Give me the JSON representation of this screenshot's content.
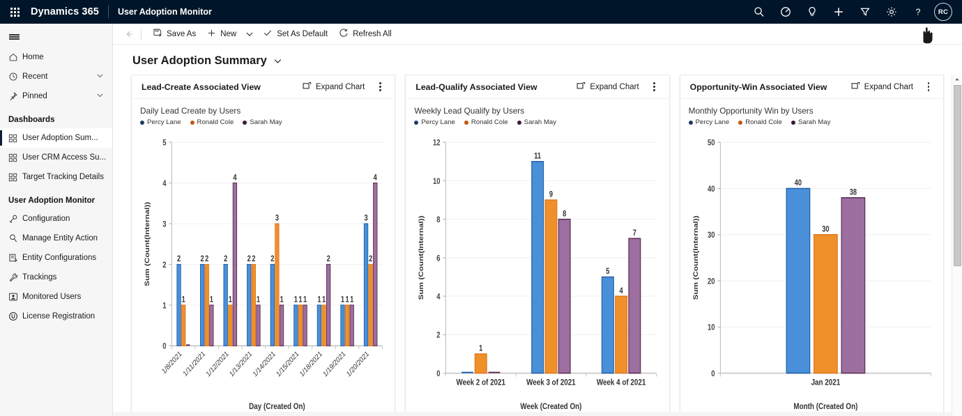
{
  "topbar": {
    "waffle_label": "app-launcher",
    "brand": "Dynamics 365",
    "app_name": "User Adoption Monitor",
    "avatar_initials": "RC",
    "icons": [
      {
        "name": "search-icon",
        "title": "Search"
      },
      {
        "name": "timer-icon",
        "title": "Focused view"
      },
      {
        "name": "lightbulb-icon",
        "title": "Assistant"
      },
      {
        "name": "plus-icon",
        "title": "Quick create"
      },
      {
        "name": "filter-icon",
        "title": "Filter"
      },
      {
        "name": "gear-icon",
        "title": "Settings"
      },
      {
        "name": "help-icon",
        "title": "Help"
      }
    ]
  },
  "sidebar": {
    "top_items": [
      {
        "label": "Home",
        "icon": "home-icon",
        "chevron": false
      },
      {
        "label": "Recent",
        "icon": "clock-icon",
        "chevron": true
      },
      {
        "label": "Pinned",
        "icon": "pin-icon",
        "chevron": true
      }
    ],
    "dashboards_header": "Dashboards",
    "dashboard_items": [
      {
        "label": "User Adoption Sum...",
        "icon": "dashboard-icon",
        "selected": true
      },
      {
        "label": "User CRM Access Su...",
        "icon": "dashboard-icon",
        "selected": false
      },
      {
        "label": "Target Tracking Details",
        "icon": "dashboard-icon",
        "selected": false
      }
    ],
    "monitor_header": "User Adoption Monitor",
    "monitor_items": [
      {
        "label": "Configuration",
        "icon": "key-icon"
      },
      {
        "label": "Manage Entity Action",
        "icon": "search-small-icon"
      },
      {
        "label": "Entity Configurations",
        "icon": "entity-icon"
      },
      {
        "label": "Trackings",
        "icon": "wrench-icon"
      },
      {
        "label": "Monitored Users",
        "icon": "user-box-icon"
      },
      {
        "label": "License Registration",
        "icon": "license-icon"
      }
    ]
  },
  "commandbar": {
    "back_label": "Back",
    "buttons": [
      {
        "label": "Save As",
        "icon": "save-as-icon",
        "caret": false
      },
      {
        "label": "New",
        "icon": "plus-icon",
        "caret": true
      },
      {
        "label": "Set As Default",
        "icon": "check-icon",
        "caret": false
      },
      {
        "label": "Refresh All",
        "icon": "refresh-icon",
        "caret": false
      }
    ]
  },
  "page": {
    "title": "User Adoption Summary"
  },
  "colors": {
    "series_percy": "#1f5ea8",
    "series_ronald": "#e0761a",
    "series_sarah": "#5c2a52",
    "series_percy_light": "#4a90d9",
    "series_ronald_light": "#f0902b",
    "series_sarah_light": "#9c6fa0",
    "nav_selected_bar": "#0b1f3a",
    "topbar_bg": "#001529"
  },
  "cards": [
    {
      "title": "Lead-Create Associated View",
      "expand_label": "Expand Chart",
      "more_label": "More commands"
    },
    {
      "title": "Lead-Qualify Associated View",
      "expand_label": "Expand Chart",
      "more_label": "More commands"
    },
    {
      "title": "Opportunity-Win Associated View",
      "expand_label": "Expand Chart",
      "more_label": "More commands"
    }
  ],
  "chart_data": [
    {
      "type": "bar",
      "title": "Daily Lead Create by Users",
      "xlabel": "Day (Created On)",
      "ylabel": "Sum (Count(Internal))",
      "ylim": [
        0,
        5
      ],
      "yticks": [
        0,
        1,
        2,
        3,
        4,
        5
      ],
      "grid": true,
      "legend_position": "top",
      "categories": [
        "1/8/2021",
        "1/11/2021",
        "1/12/2021",
        "1/13/2021",
        "1/14/2021",
        "1/15/2021",
        "1/18/2021",
        "1/19/2021",
        "1/20/2021"
      ],
      "series": [
        {
          "name": "Percy Lane",
          "color": "#1f5ea8",
          "values": [
            2,
            2,
            2,
            2,
            2,
            1,
            1,
            1,
            3
          ]
        },
        {
          "name": "Ronald Cole",
          "color": "#e0761a",
          "values": [
            1,
            2,
            1,
            2,
            3,
            1,
            1,
            1,
            2
          ]
        },
        {
          "name": "Sarah May",
          "color": "#5c2a52",
          "values": [
            0,
            1,
            4,
            1,
            1,
            1,
            2,
            1,
            4
          ]
        }
      ]
    },
    {
      "type": "bar",
      "title": "Weekly Lead Qualify by Users",
      "xlabel": "Week (Created On)",
      "ylabel": "Sum (Count(Internal))",
      "ylim": [
        0,
        12
      ],
      "yticks": [
        0,
        2,
        4,
        6,
        8,
        10,
        12
      ],
      "grid": true,
      "legend_position": "top",
      "categories": [
        "Week 2 of 2021",
        "Week 3 of 2021",
        "Week 4 of 2021"
      ],
      "series": [
        {
          "name": "Percy Lane",
          "color": "#1f5ea8",
          "values": [
            0,
            11,
            5
          ]
        },
        {
          "name": "Ronald Cole",
          "color": "#e0761a",
          "values": [
            1,
            9,
            4
          ]
        },
        {
          "name": "Sarah May",
          "color": "#5c2a52",
          "values": [
            0,
            8,
            7
          ]
        }
      ]
    },
    {
      "type": "bar",
      "title": "Monthly Opportunity Win by Users",
      "xlabel": "Month (Created On)",
      "ylabel": "Sum (Count(Internal))",
      "ylim": [
        0,
        50
      ],
      "yticks": [
        0,
        10,
        20,
        30,
        40,
        50
      ],
      "grid": true,
      "legend_position": "top",
      "categories": [
        "Jan 2021"
      ],
      "series": [
        {
          "name": "Percy Lane",
          "color": "#1f5ea8",
          "values": [
            40
          ]
        },
        {
          "name": "Ronald Cole",
          "color": "#e0761a",
          "values": [
            30
          ]
        },
        {
          "name": "Sarah May",
          "color": "#5c2a52",
          "values": [
            38
          ]
        }
      ]
    }
  ]
}
